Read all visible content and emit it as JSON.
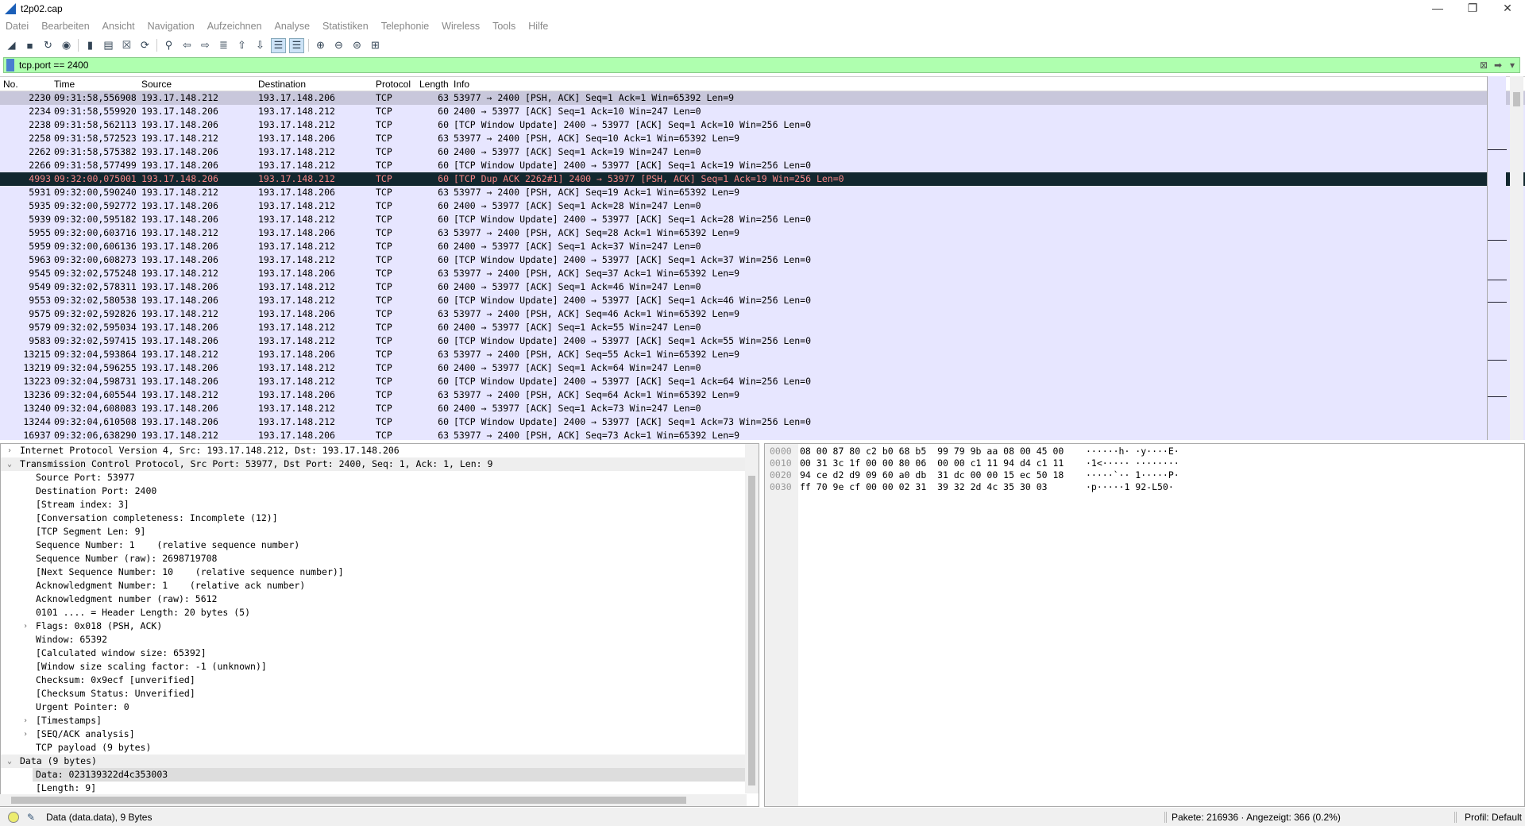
{
  "window": {
    "title": "t2p02.cap",
    "controls": [
      "—",
      "❐",
      "✕"
    ]
  },
  "menu": [
    "Datei",
    "Bearbeiten",
    "Ansicht",
    "Navigation",
    "Aufzeichnen",
    "Analyse",
    "Statistiken",
    "Telephonie",
    "Wireless",
    "Tools",
    "Hilfe"
  ],
  "toolbar": [
    {
      "icon": "shark-fin-start-icon",
      "glyph": "◢"
    },
    {
      "icon": "stop-icon",
      "glyph": "■"
    },
    {
      "icon": "restart-icon",
      "glyph": "↻"
    },
    {
      "icon": "capture-options-icon",
      "glyph": "◉"
    },
    {
      "icon": "open-file-icon",
      "glyph": "▮"
    },
    {
      "icon": "save-file-icon",
      "glyph": "▤"
    },
    {
      "icon": "close-file-icon",
      "glyph": "☒"
    },
    {
      "icon": "reload-icon",
      "glyph": "⟳"
    },
    {
      "icon": "find-icon",
      "glyph": "⚲"
    },
    {
      "icon": "go-back-icon",
      "glyph": "⇦"
    },
    {
      "icon": "go-forward-icon",
      "glyph": "⇨"
    },
    {
      "icon": "go-to-packet-icon",
      "glyph": "≣"
    },
    {
      "icon": "first-packet-icon",
      "glyph": "⇧"
    },
    {
      "icon": "last-packet-icon",
      "glyph": "⇩"
    },
    {
      "icon": "autoscroll-icon",
      "glyph": "☰",
      "active": true
    },
    {
      "icon": "colorize-icon",
      "glyph": "☰",
      "active": true
    },
    {
      "icon": "zoom-in-icon",
      "glyph": "⊕"
    },
    {
      "icon": "zoom-out-icon",
      "glyph": "⊖"
    },
    {
      "icon": "zoom-normal-icon",
      "glyph": "⊜"
    },
    {
      "icon": "resize-columns-icon",
      "glyph": "⊞"
    }
  ],
  "filter": {
    "value": "tcp.port == 2400",
    "color": "#afffaf"
  },
  "columns": [
    "No.",
    "Time",
    "Source",
    "Destination",
    "Protocol",
    "Length",
    "Info"
  ],
  "packets": [
    [
      "2230",
      "09:31:58,556908",
      "193.17.148.212",
      "193.17.148.206",
      "TCP",
      "63",
      "53977 → 2400 [PSH, ACK] Seq=1 Ack=1 Win=65392 Len=9"
    ],
    [
      "2234",
      "09:31:58,559920",
      "193.17.148.206",
      "193.17.148.212",
      "TCP",
      "60",
      "2400 → 53977 [ACK] Seq=1 Ack=10 Win=247 Len=0"
    ],
    [
      "2238",
      "09:31:58,562113",
      "193.17.148.206",
      "193.17.148.212",
      "TCP",
      "60",
      "[TCP Window Update] 2400 → 53977 [ACK] Seq=1 Ack=10 Win=256 Len=0"
    ],
    [
      "2258",
      "09:31:58,572523",
      "193.17.148.212",
      "193.17.148.206",
      "TCP",
      "63",
      "53977 → 2400 [PSH, ACK] Seq=10 Ack=1 Win=65392 Len=9"
    ],
    [
      "2262",
      "09:31:58,575382",
      "193.17.148.206",
      "193.17.148.212",
      "TCP",
      "60",
      "2400 → 53977 [ACK] Seq=1 Ack=19 Win=247 Len=0"
    ],
    [
      "2266",
      "09:31:58,577499",
      "193.17.148.206",
      "193.17.148.212",
      "TCP",
      "60",
      "[TCP Window Update] 2400 → 53977 [ACK] Seq=1 Ack=19 Win=256 Len=0"
    ],
    [
      "4993",
      "09:32:00,075001",
      "193.17.148.206",
      "193.17.148.212",
      "TCP",
      "60",
      "[TCP Dup ACK 2262#1] 2400 → 53977 [PSH, ACK] Seq=1 Ack=19 Win=256 Len=0"
    ],
    [
      "5931",
      "09:32:00,590240",
      "193.17.148.212",
      "193.17.148.206",
      "TCP",
      "63",
      "53977 → 2400 [PSH, ACK] Seq=19 Ack=1 Win=65392 Len=9"
    ],
    [
      "5935",
      "09:32:00,592772",
      "193.17.148.206",
      "193.17.148.212",
      "TCP",
      "60",
      "2400 → 53977 [ACK] Seq=1 Ack=28 Win=247 Len=0"
    ],
    [
      "5939",
      "09:32:00,595182",
      "193.17.148.206",
      "193.17.148.212",
      "TCP",
      "60",
      "[TCP Window Update] 2400 → 53977 [ACK] Seq=1 Ack=28 Win=256 Len=0"
    ],
    [
      "5955",
      "09:32:00,603716",
      "193.17.148.212",
      "193.17.148.206",
      "TCP",
      "63",
      "53977 → 2400 [PSH, ACK] Seq=28 Ack=1 Win=65392 Len=9"
    ],
    [
      "5959",
      "09:32:00,606136",
      "193.17.148.206",
      "193.17.148.212",
      "TCP",
      "60",
      "2400 → 53977 [ACK] Seq=1 Ack=37 Win=247 Len=0"
    ],
    [
      "5963",
      "09:32:00,608273",
      "193.17.148.206",
      "193.17.148.212",
      "TCP",
      "60",
      "[TCP Window Update] 2400 → 53977 [ACK] Seq=1 Ack=37 Win=256 Len=0"
    ],
    [
      "9545",
      "09:32:02,575248",
      "193.17.148.212",
      "193.17.148.206",
      "TCP",
      "63",
      "53977 → 2400 [PSH, ACK] Seq=37 Ack=1 Win=65392 Len=9"
    ],
    [
      "9549",
      "09:32:02,578311",
      "193.17.148.206",
      "193.17.148.212",
      "TCP",
      "60",
      "2400 → 53977 [ACK] Seq=1 Ack=46 Win=247 Len=0"
    ],
    [
      "9553",
      "09:32:02,580538",
      "193.17.148.206",
      "193.17.148.212",
      "TCP",
      "60",
      "[TCP Window Update] 2400 → 53977 [ACK] Seq=1 Ack=46 Win=256 Len=0"
    ],
    [
      "9575",
      "09:32:02,592826",
      "193.17.148.212",
      "193.17.148.206",
      "TCP",
      "63",
      "53977 → 2400 [PSH, ACK] Seq=46 Ack=1 Win=65392 Len=9"
    ],
    [
      "9579",
      "09:32:02,595034",
      "193.17.148.206",
      "193.17.148.212",
      "TCP",
      "60",
      "2400 → 53977 [ACK] Seq=1 Ack=55 Win=247 Len=0"
    ],
    [
      "9583",
      "09:32:02,597415",
      "193.17.148.206",
      "193.17.148.212",
      "TCP",
      "60",
      "[TCP Window Update] 2400 → 53977 [ACK] Seq=1 Ack=55 Win=256 Len=0"
    ],
    [
      "13215",
      "09:32:04,593864",
      "193.17.148.212",
      "193.17.148.206",
      "TCP",
      "63",
      "53977 → 2400 [PSH, ACK] Seq=55 Ack=1 Win=65392 Len=9"
    ],
    [
      "13219",
      "09:32:04,596255",
      "193.17.148.206",
      "193.17.148.212",
      "TCP",
      "60",
      "2400 → 53977 [ACK] Seq=1 Ack=64 Win=247 Len=0"
    ],
    [
      "13223",
      "09:32:04,598731",
      "193.17.148.206",
      "193.17.148.212",
      "TCP",
      "60",
      "[TCP Window Update] 2400 → 53977 [ACK] Seq=1 Ack=64 Win=256 Len=0"
    ],
    [
      "13236",
      "09:32:04,605544",
      "193.17.148.212",
      "193.17.148.206",
      "TCP",
      "63",
      "53977 → 2400 [PSH, ACK] Seq=64 Ack=1 Win=65392 Len=9"
    ],
    [
      "13240",
      "09:32:04,608083",
      "193.17.148.206",
      "193.17.148.212",
      "TCP",
      "60",
      "2400 → 53977 [ACK] Seq=1 Ack=73 Win=247 Len=0"
    ],
    [
      "13244",
      "09:32:04,610508",
      "193.17.148.206",
      "193.17.148.212",
      "TCP",
      "60",
      "[TCP Window Update] 2400 → 53977 [ACK] Seq=1 Ack=73 Win=256 Len=0"
    ],
    [
      "16937",
      "09:32:06,638290",
      "193.17.148.212",
      "193.17.148.206",
      "TCP",
      "63",
      "53977 → 2400 [PSH, ACK] Seq=73 Ack=1 Win=65392 Len=9"
    ]
  ],
  "details": [
    {
      "t": "Internet Protocol Version 4, Src: 193.17.148.212, Dst: 193.17.148.206",
      "lvl": 0,
      "exp": "closed"
    },
    {
      "t": "Transmission Control Protocol, Src Port: 53977, Dst Port: 2400, Seq: 1, Ack: 1, Len: 9",
      "lvl": 0,
      "exp": "open",
      "hl": true
    },
    {
      "t": "Source Port: 53977",
      "lvl": 1
    },
    {
      "t": "Destination Port: 2400",
      "lvl": 1
    },
    {
      "t": "[Stream index: 3]",
      "lvl": 1
    },
    {
      "t": "[Conversation completeness: Incomplete (12)]",
      "lvl": 1
    },
    {
      "t": "[TCP Segment Len: 9]",
      "lvl": 1
    },
    {
      "t": "Sequence Number: 1    (relative sequence number)",
      "lvl": 1
    },
    {
      "t": "Sequence Number (raw): 2698719708",
      "lvl": 1
    },
    {
      "t": "[Next Sequence Number: 10    (relative sequence number)]",
      "lvl": 1
    },
    {
      "t": "Acknowledgment Number: 1    (relative ack number)",
      "lvl": 1
    },
    {
      "t": "Acknowledgment number (raw): 5612",
      "lvl": 1
    },
    {
      "t": "0101 .... = Header Length: 20 bytes (5)",
      "lvl": 1
    },
    {
      "t": "Flags: 0x018 (PSH, ACK)",
      "lvl": 1,
      "exp": "closed"
    },
    {
      "t": "Window: 65392",
      "lvl": 1
    },
    {
      "t": "[Calculated window size: 65392]",
      "lvl": 1
    },
    {
      "t": "[Window size scaling factor: -1 (unknown)]",
      "lvl": 1
    },
    {
      "t": "Checksum: 0x9ecf [unverified]",
      "lvl": 1
    },
    {
      "t": "[Checksum Status: Unverified]",
      "lvl": 1
    },
    {
      "t": "Urgent Pointer: 0",
      "lvl": 1
    },
    {
      "t": "[Timestamps]",
      "lvl": 1,
      "exp": "closed"
    },
    {
      "t": "[SEQ/ACK analysis]",
      "lvl": 1,
      "exp": "closed"
    },
    {
      "t": "TCP payload (9 bytes)",
      "lvl": 1
    },
    {
      "t": "Data (9 bytes)",
      "lvl": 0,
      "exp": "open",
      "hl": true
    },
    {
      "t": "Data: 023139322d4c353003",
      "lvl": 1,
      "sel": true
    },
    {
      "t": "[Length: 9]",
      "lvl": 1
    }
  ],
  "hex": [
    {
      "off": "0000",
      "hex": "08 00 87 80 c2 b0 68 b5  99 79 9b aa 08 00 45 00",
      "ascii": "······h· ·y····E·"
    },
    {
      "off": "0010",
      "hex": "00 31 3c 1f 00 00 80 06  00 00 c1 11 94 d4 c1 11",
      "ascii": "·1<····· ········"
    },
    {
      "off": "0020",
      "hex": "94 ce d2 d9 09 60 a0 db  31 dc 00 00 15 ec 50 18",
      "ascii": "·····`·· 1·····P·"
    },
    {
      "off": "0030",
      "hex": "ff 70 9e cf 00 00 02 31  39 32 2d 4c 35 30 03",
      "ascii": "·p·····1 92-L50·"
    }
  ],
  "status": {
    "field": "Data (data.data), 9 Bytes",
    "packets": "Pakete: 216936 · Angezeigt: 366 (0.2%)",
    "profile": "Profil: Default"
  }
}
